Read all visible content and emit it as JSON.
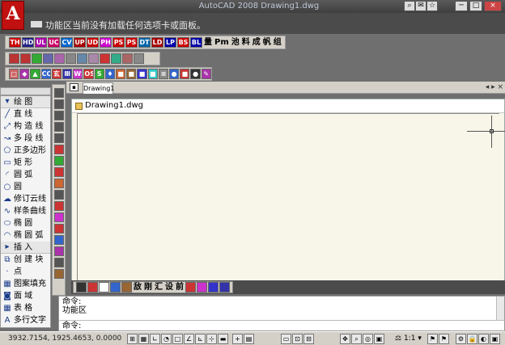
{
  "window": {
    "title": "AutoCAD 2008 Drawing1.dwg",
    "logo": "A",
    "title_buttons": [
      "?",
      "?",
      "?",
      "?",
      "?",
      "?"
    ]
  },
  "ribbon": {
    "message": "功能区当前没有加载任何选项卡或面板。"
  },
  "toolbar1": {
    "items": [
      "TH",
      "HD",
      "UL",
      "UC",
      "CV",
      "UP",
      "UD",
      "PH",
      "PS",
      "PS",
      "DT",
      "LD",
      "LP",
      "BS",
      "BL",
      "量",
      "Pm",
      "池",
      "料",
      "成",
      "帆",
      "组"
    ]
  },
  "toolbar2": {
    "icons": [
      "pan-icon",
      "zoom-icon",
      "zoom-icon",
      "undo-icon",
      "redo-icon",
      "zoom-window-icon",
      "zoom-extents-icon",
      "palette-icon",
      "properties-icon",
      "layers-icon",
      "matchprop-icon",
      "grid-icon"
    ]
  },
  "toolbar3": {
    "items": [
      "□",
      "◆",
      "▲",
      "CO",
      "玄",
      "Ⅲ",
      "WS",
      "OS",
      "S",
      "♦",
      "■",
      "■",
      "■",
      "■",
      "≡",
      "●",
      "■",
      "●",
      "✎"
    ]
  },
  "left_panel": {
    "draw_header": "绘      图",
    "draw_items": [
      {
        "icon": "line-icon",
        "label": "直      线"
      },
      {
        "icon": "construction-line-icon",
        "label": "构 造 线"
      },
      {
        "icon": "polyline-icon",
        "label": "多 段 线"
      },
      {
        "icon": "polygon-icon",
        "label": "正多边形"
      },
      {
        "icon": "rectangle-icon",
        "label": "矩      形"
      },
      {
        "icon": "arc-icon",
        "label": "圆      弧"
      },
      {
        "icon": "circle-icon",
        "label": "圆"
      },
      {
        "icon": "revcloud-icon",
        "label": "修订云线"
      },
      {
        "icon": "spline-icon",
        "label": "样条曲线"
      },
      {
        "icon": "ellipse-icon",
        "label": "椭      圆"
      },
      {
        "icon": "ellipse-arc-icon",
        "label": "椭 圆 弧"
      }
    ],
    "insert_header": "插      入",
    "insert_items": [
      {
        "icon": "block-icon",
        "label": "创 建 块"
      },
      {
        "icon": "point-icon",
        "label": "点"
      },
      {
        "icon": "hatch-icon",
        "label": "图案填充"
      },
      {
        "icon": "region-icon",
        "label": "面      域"
      },
      {
        "icon": "table-icon",
        "label": "表      格"
      },
      {
        "icon": "mtext-icon",
        "label": "多行文字"
      }
    ]
  },
  "document": {
    "tab_label": "Drawing1",
    "title": "Drawing1.dwg",
    "controls": "◂ ▸ ×"
  },
  "bottom_toolbar": {
    "items": [
      "敌",
      "刚",
      "汇",
      "设",
      "前"
    ]
  },
  "command": {
    "line1": "命令:",
    "line2": "功能区",
    "prompt": "命令:"
  },
  "status": {
    "coords": "3932.7154, 1925.4653, 0.0000",
    "scale": "1:1"
  }
}
